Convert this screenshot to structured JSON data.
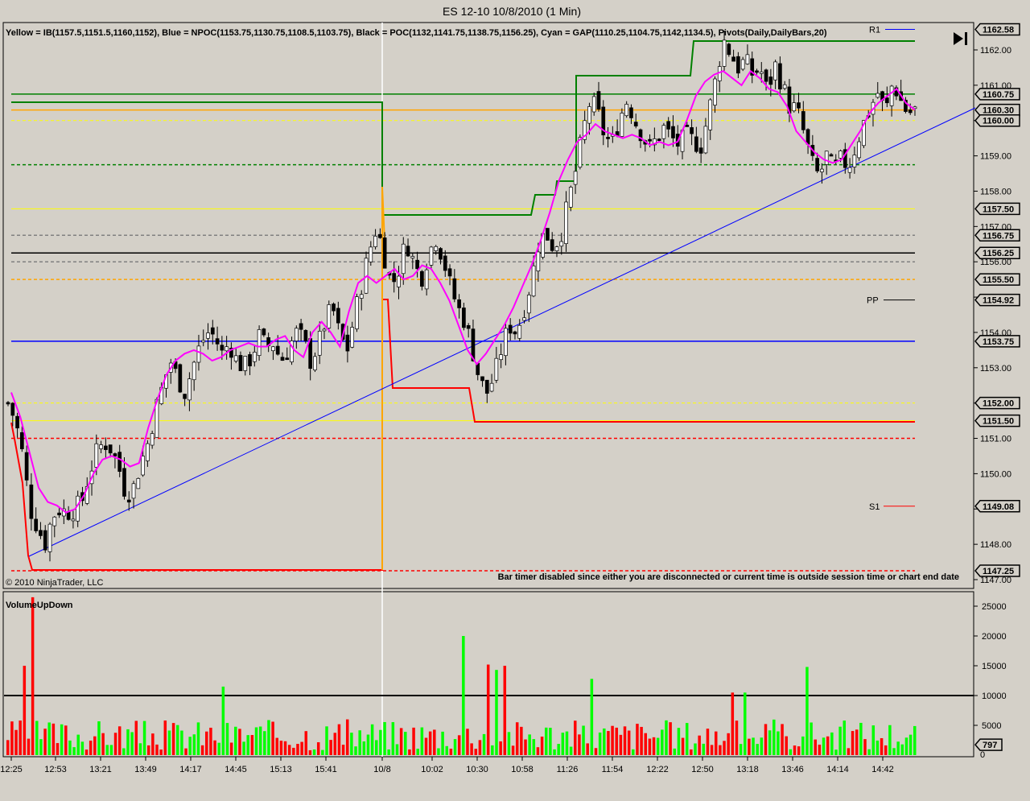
{
  "window": {
    "title": "ES 12-10  10/8/2010 (1 Min)"
  },
  "header": {
    "info": "Yellow = IB(1157.5,1151.5,1160,1152), Blue = NPOC(1153.75,1130.75,1108.5,1103.75), Black = POC(1132,1141.75,1138.75,1156.25), Cyan = GAP(1110.25,1104.75,1142,1134.5), Pivots(Daily,DailyBars,20)"
  },
  "footer": {
    "copyright": "© 2010 NinjaTrader, LLC",
    "bar_timer": "Bar timer disabled since either you are disconnected or current time is outside session time or chart end date"
  },
  "toolbar": {
    "go_to_end_icon": "skip-to-end-icon"
  },
  "colors": {
    "background": "#d4d0c8",
    "yellow": "#ffff00",
    "orange": "#ffa500",
    "green": "#008000",
    "red": "#ff0000",
    "blue": "#0000ff",
    "magenta": "#ff00ff",
    "gray": "#808080",
    "vol_up": "#00ff00",
    "vol_down": "#ff0000"
  },
  "chart_data": [
    {
      "type": "candlestick",
      "title": "ES 12-10  10/8/2010 (1 Min)",
      "ylim": [
        1147.0,
        1162.8
      ],
      "y_ticks": [
        "1147.00",
        "1148.00",
        "1149.00",
        "1150.00",
        "1151.00",
        "1152.00",
        "1153.00",
        "1154.00",
        "1155.00",
        "1156.00",
        "1157.00",
        "1158.00",
        "1159.00",
        "1160.00",
        "1161.00",
        "1162.00"
      ],
      "x_ticks": [
        "12:25",
        "12:53",
        "13:21",
        "13:49",
        "14:17",
        "14:45",
        "15:13",
        "15:41",
        "10/8",
        "10:02",
        "10:30",
        "10:58",
        "11:26",
        "11:54",
        "12:22",
        "12:50",
        "13:18",
        "13:46",
        "14:14",
        "14:42"
      ],
      "price_tags": [
        "1162.58",
        "1160.75",
        "1160.30",
        "1160.00",
        "1157.50",
        "1156.75",
        "1156.25",
        "1155.50",
        "1154.92",
        "1153.75",
        "1152.00",
        "1151.50",
        "1149.08",
        "1147.25"
      ],
      "pivot_labels": {
        "r1": "R1",
        "pp": "PP",
        "s1": "S1"
      },
      "key_prices": [
        {
          "price": 1160.75,
          "color": "#008000",
          "style": "solid"
        },
        {
          "price": 1160.3,
          "color": "#ffa500",
          "style": "solid"
        },
        {
          "price": 1160.0,
          "color": "#ffff00",
          "style": "dashed"
        },
        {
          "price": 1158.75,
          "color": "#008000",
          "style": "dashed"
        },
        {
          "price": 1157.5,
          "color": "#ffff00",
          "style": "solid"
        },
        {
          "price": 1156.75,
          "color": "#808080",
          "style": "dashed"
        },
        {
          "price": 1156.25,
          "color": "#000000",
          "style": "solid"
        },
        {
          "price": 1156.0,
          "color": "#808080",
          "style": "dashed"
        },
        {
          "price": 1155.5,
          "color": "#ffa500",
          "style": "dashed"
        },
        {
          "price": 1153.75,
          "color": "#0000ff",
          "style": "solid"
        },
        {
          "price": 1152.0,
          "color": "#ffff00",
          "style": "dashed"
        },
        {
          "price": 1151.5,
          "color": "#ffff00",
          "style": "solid"
        },
        {
          "price": 1151.0,
          "color": "#ff0000",
          "style": "dashed"
        },
        {
          "price": 1147.25,
          "color": "#ff0000",
          "style": "dashed"
        }
      ],
      "close_path": [
        1152.0,
        1151.5,
        1150.5,
        1149.0,
        1148.5,
        1148.0,
        1148.8,
        1149.0,
        1148.9,
        1149.0,
        1149.2,
        1150.0,
        1150.6,
        1150.9,
        1150.7,
        1150.2,
        1149.4,
        1149.6,
        1150.3,
        1150.9,
        1151.8,
        1152.5,
        1153.2,
        1152.7,
        1152.3,
        1153.0,
        1153.6,
        1154.0,
        1153.9,
        1153.4,
        1153.7,
        1153.2,
        1153.0,
        1153.3,
        1153.9,
        1153.6,
        1153.7,
        1153.2,
        1153.5,
        1154.0,
        1153.8,
        1153.2,
        1153.6,
        1154.3,
        1154.7,
        1153.9,
        1153.5,
        1154.5,
        1155.4,
        1156.3,
        1157.0,
        1156.2,
        1155.3,
        1155.8,
        1156.6,
        1156.0,
        1155.5,
        1156.2,
        1156.7,
        1156.1,
        1155.3,
        1154.7,
        1154.3,
        1153.5,
        1152.6,
        1152.3,
        1152.8,
        1153.6,
        1154.2,
        1154.0,
        1154.7,
        1155.5,
        1156.6,
        1156.8,
        1156.4,
        1156.8,
        1157.7,
        1158.6,
        1159.7,
        1160.6,
        1160.2,
        1159.5,
        1159.4,
        1160.1,
        1160.6,
        1160.0,
        1159.6,
        1159.2,
        1159.5,
        1159.8,
        1159.5,
        1159.3,
        1159.6,
        1159.4,
        1159.3,
        1160.2,
        1161.2,
        1162.3,
        1161.9,
        1161.5,
        1161.7,
        1161.3,
        1161.5,
        1160.8,
        1161.6,
        1161.0,
        1160.4,
        1160.3,
        1159.6,
        1158.8,
        1158.4,
        1159.0,
        1158.6,
        1158.9,
        1158.7,
        1159.3,
        1159.9,
        1160.4,
        1160.8,
        1160.2,
        1161.1,
        1160.6,
        1160.2,
        1160.3
      ],
      "ma_path": [
        1152.3,
        1151.6,
        1150.6,
        1149.6,
        1149.2,
        1149.1,
        1148.9,
        1149.0,
        1149.4,
        1150.0,
        1150.4,
        1150.5,
        1150.4,
        1150.2,
        1150.3,
        1151.3,
        1152.1,
        1152.8,
        1153.2,
        1153.4,
        1153.5,
        1153.4,
        1153.2,
        1153.3,
        1153.5,
        1153.6,
        1153.7,
        1153.6,
        1153.6,
        1153.8,
        1153.9,
        1153.5,
        1153.3,
        1154.0,
        1154.3,
        1154.0,
        1153.6,
        1154.6,
        1155.4,
        1155.6,
        1155.4,
        1155.6,
        1155.8,
        1155.5,
        1155.6,
        1155.9,
        1155.8,
        1155.4,
        1154.9,
        1154.2,
        1153.5,
        1153.1,
        1153.4,
        1153.8,
        1154.2,
        1154.7,
        1155.3,
        1155.9,
        1156.6,
        1157.4,
        1158.3,
        1158.9,
        1159.4,
        1159.6,
        1159.9,
        1159.7,
        1159.6,
        1159.5,
        1159.6,
        1159.5,
        1159.3,
        1159.4,
        1159.3,
        1159.4,
        1160.0,
        1160.7,
        1161.1,
        1161.3,
        1161.4,
        1161.2,
        1161.0,
        1161.4,
        1161.2,
        1160.9,
        1160.8,
        1160.4,
        1159.7,
        1159.4,
        1159.1,
        1158.9,
        1158.8,
        1158.9,
        1159.3,
        1159.7,
        1160.2,
        1160.5,
        1160.7,
        1160.9,
        1160.5,
        1160.3
      ]
    },
    {
      "type": "bar",
      "title": "VolumeUpDown",
      "ylim": [
        0,
        27000
      ],
      "y_ticks": [
        "5000",
        "10000",
        "15000",
        "20000",
        "25000"
      ],
      "last_value_tag": "797",
      "zero_label": "0",
      "reference_line": 10000,
      "series": [
        {
          "name": "up",
          "color": "#00ff00"
        },
        {
          "name": "down",
          "color": "#ff0000"
        }
      ],
      "spikes": [
        {
          "slot": 6,
          "value": 26500,
          "dir": "down"
        },
        {
          "slot": 4,
          "value": 15000,
          "dir": "down"
        },
        {
          "slot": 52,
          "value": 11500,
          "dir": "up"
        },
        {
          "slot": 110,
          "value": 20000,
          "dir": "up"
        },
        {
          "slot": 116,
          "value": 15200,
          "dir": "down"
        },
        {
          "slot": 118,
          "value": 14300,
          "dir": "up"
        },
        {
          "slot": 120,
          "value": 15000,
          "dir": "down"
        },
        {
          "slot": 141,
          "value": 12800,
          "dir": "up"
        },
        {
          "slot": 193,
          "value": 14800,
          "dir": "up"
        },
        {
          "slot": 175,
          "value": 10500,
          "dir": "down"
        },
        {
          "slot": 178,
          "value": 10500,
          "dir": "up"
        }
      ]
    }
  ]
}
